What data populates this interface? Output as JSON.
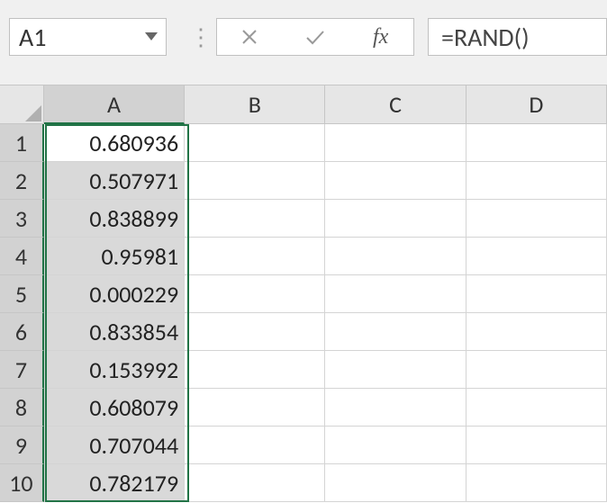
{
  "name_box": {
    "value": "A1"
  },
  "formula_bar": {
    "formula": "=RAND()",
    "fx_label": "fx"
  },
  "columns": [
    "A",
    "B",
    "C",
    "D"
  ],
  "selected_column_index": 0,
  "rows": [
    {
      "num": "1",
      "a": "0.680936"
    },
    {
      "num": "2",
      "a": "0.507971"
    },
    {
      "num": "3",
      "a": "0.838899"
    },
    {
      "num": "4",
      "a": "0.95981"
    },
    {
      "num": "5",
      "a": "0.000229"
    },
    {
      "num": "6",
      "a": "0.833854"
    },
    {
      "num": "7",
      "a": "0.153992"
    },
    {
      "num": "8",
      "a": "0.608079"
    },
    {
      "num": "9",
      "a": "0.707044"
    },
    {
      "num": "10",
      "a": "0.782179"
    }
  ],
  "colors": {
    "selection": "#217346"
  }
}
